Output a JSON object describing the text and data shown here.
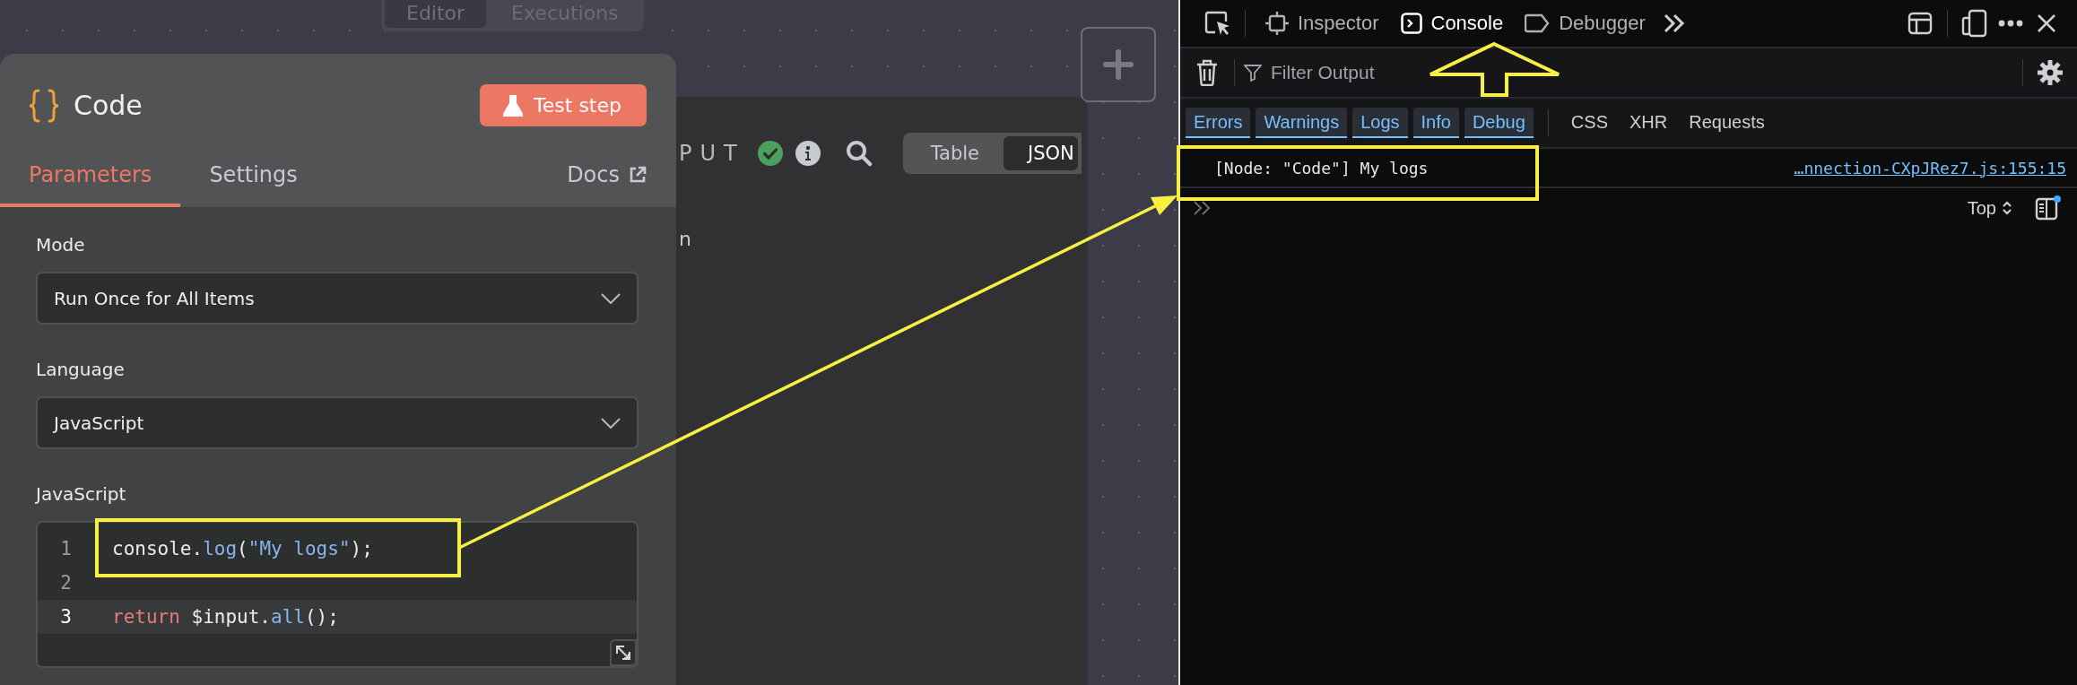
{
  "canvas": {
    "view_toggle": [
      {
        "label": "Editor",
        "selected": true
      },
      {
        "label": "Executions",
        "selected": false
      }
    ]
  },
  "output_panel": {
    "title": "PUT",
    "partial_text": "n",
    "view_toggle": [
      {
        "label": "Table",
        "selected": false
      },
      {
        "label": "JSON",
        "selected": true
      }
    ]
  },
  "node_panel": {
    "title": "Code",
    "test_button": "Test step",
    "tabs": [
      {
        "label": "Parameters",
        "selected": true
      },
      {
        "label": "Settings",
        "selected": false
      }
    ],
    "docs_link": "Docs",
    "fields": [
      {
        "label": "Mode",
        "value": "Run Once for All Items"
      },
      {
        "label": "Language",
        "value": "JavaScript"
      }
    ],
    "editor": {
      "label": "JavaScript",
      "lines": [
        {
          "number": "1",
          "active": false,
          "tokens": [
            {
              "text": "console.",
              "kind": "plain"
            },
            {
              "text": "log",
              "kind": "function"
            },
            {
              "text": "(",
              "kind": "plain"
            },
            {
              "text": "\"My logs\"",
              "kind": "string"
            },
            {
              "text": ");",
              "kind": "plain"
            }
          ]
        },
        {
          "number": "2",
          "active": false
        },
        {
          "number": "3",
          "active": true,
          "tokens": [
            {
              "text": "return",
              "kind": "keyword"
            },
            {
              "text": " $input.",
              "kind": "plain"
            },
            {
              "text": "all",
              "kind": "function"
            },
            {
              "text": "();",
              "kind": "plain"
            }
          ]
        }
      ]
    }
  },
  "devtools": {
    "tabs": [
      {
        "label": "Inspector",
        "selected": false
      },
      {
        "label": "Console",
        "selected": true
      },
      {
        "label": "Debugger",
        "selected": false
      }
    ],
    "filter": {
      "placeholder": "Filter Output"
    },
    "levels": [
      {
        "label": "Errors",
        "selected": true
      },
      {
        "label": "Warnings",
        "selected": true
      },
      {
        "label": "Logs",
        "selected": true
      },
      {
        "label": "Info",
        "selected": true
      },
      {
        "label": "Debug",
        "selected": true
      }
    ],
    "request_filters": [
      {
        "label": "CSS",
        "selected": false
      },
      {
        "label": "XHR",
        "selected": false
      },
      {
        "label": "Requests",
        "selected": false
      }
    ],
    "messages": [
      {
        "text": "[Node: \"Code\"] My logs",
        "source": "…nnection-CXpJRez7.js:155:15"
      }
    ],
    "context": "Top"
  }
}
